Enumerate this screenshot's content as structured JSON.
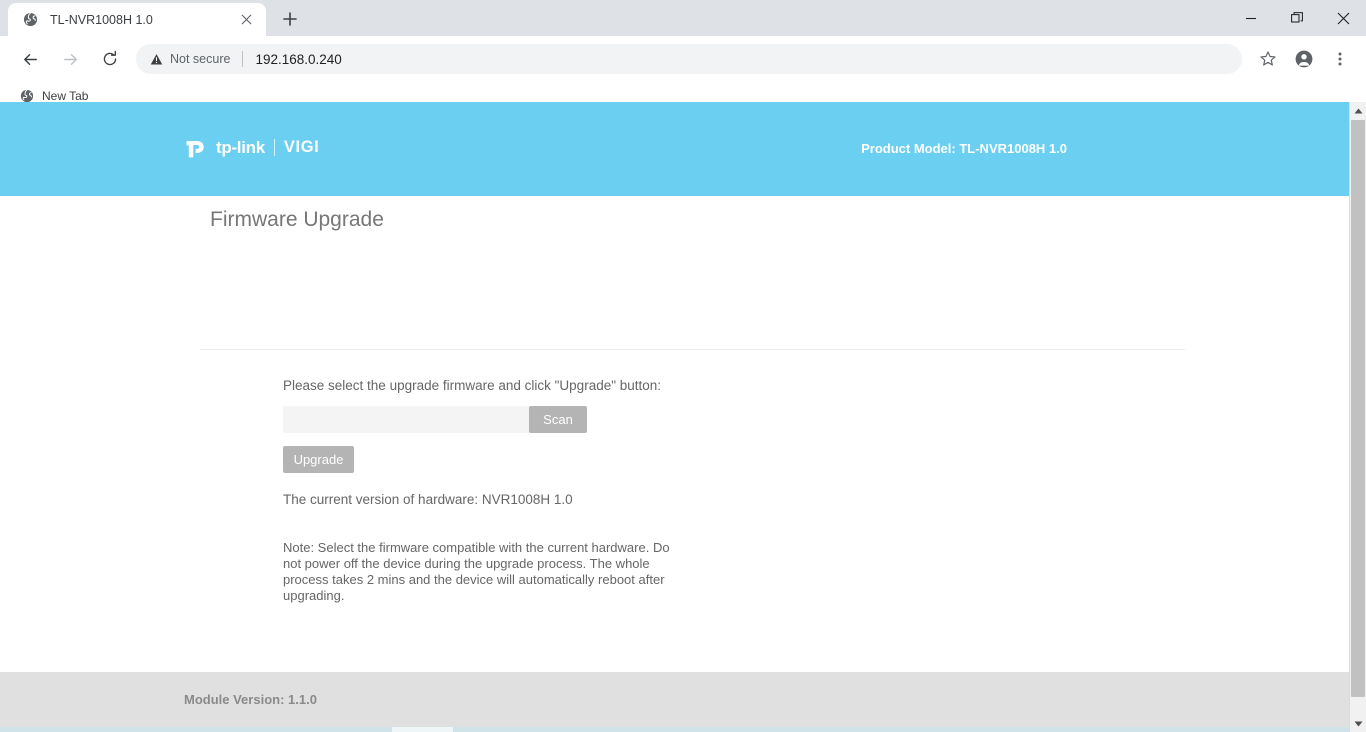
{
  "browser": {
    "tab": {
      "title": "TL-NVR1008H 1.0",
      "favicon": "globe-icon",
      "close": "close-icon"
    },
    "new_tab_button": "new-tab-plus-icon",
    "window_controls": {
      "minimize": "minimize-icon",
      "restore": "restore-icon",
      "close": "close-icon"
    },
    "nav": {
      "back": "back-arrow-icon",
      "forward": "forward-arrow-icon",
      "reload": "reload-icon"
    },
    "omnibox": {
      "security_icon": "warning-triangle-icon",
      "security_label": "Not secure",
      "url": "192.168.0.240"
    },
    "toolbar_icons": {
      "bookmark": "star-icon",
      "profile": "account-avatar-icon",
      "menu": "three-dot-menu-icon"
    },
    "bookmarks": [
      {
        "label": "New Tab",
        "icon": "globe-icon"
      }
    ]
  },
  "site": {
    "header": {
      "logo_primary": "tp-link",
      "logo_secondary": "VIGI",
      "logo_mark": "tp-link-logo-icon",
      "product_model": "Product Model: TL-NVR1008H 1.0",
      "background_color": "#6ACFF0"
    },
    "main": {
      "page_title": "Firmware Upgrade",
      "instruction": "Please select the upgrade firmware and click \"Upgrade\" button:",
      "file_input_value": "",
      "file_input_placeholder": "",
      "scan_button": "Scan",
      "upgrade_button": "Upgrade",
      "hardware_version": "The current version of hardware: NVR1008H 1.0",
      "note": "Note: Select the firmware compatible with the current hardware. Do not power off the device during the upgrade process. The whole process takes 2 mins and the device will automatically reboot after upgrading."
    },
    "footer": {
      "module_version": "Module Version: 1.1.0",
      "background_color": "#e0e0e0"
    }
  },
  "scrollbar": {
    "up_arrow": "scroll-up-arrow-icon",
    "down_arrow": "scroll-down-arrow-icon"
  }
}
